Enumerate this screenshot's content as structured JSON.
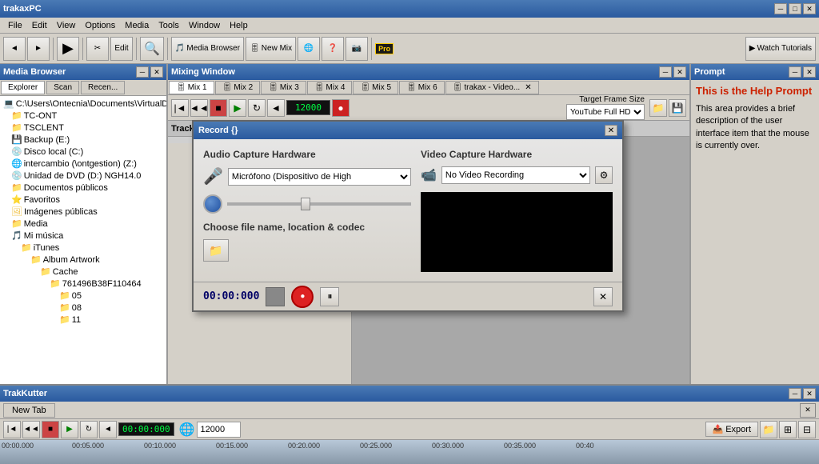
{
  "app": {
    "title": "trakaxPC",
    "title_controls": [
      "minimize",
      "maximize",
      "close"
    ]
  },
  "menu": {
    "items": [
      "File",
      "Edit",
      "View",
      "Options",
      "Media",
      "Tools",
      "Window",
      "Help"
    ]
  },
  "toolbar": {
    "buttons": [
      "back",
      "forward",
      "play",
      "edit",
      "search",
      "media_browser",
      "new_mix",
      "globe",
      "help",
      "camera",
      "watch_tutorials"
    ],
    "media_browser_label": "Media Browser",
    "new_mix_label": "New Mix",
    "watch_tutorials_label": "Watch Tutorials",
    "pro_badge": "Pro"
  },
  "left_panel": {
    "title": "Media Browser",
    "tabs": [
      "Explorer",
      "Scan",
      "Recen..."
    ],
    "tree": [
      {
        "label": "C:\\Users\\Ontecnia\\Documents\\VirtualDJL...",
        "level": 0
      },
      {
        "label": "TC-ONT",
        "level": 1
      },
      {
        "label": "TSCLENT",
        "level": 1
      },
      {
        "label": "Backup (E:)",
        "level": 1
      },
      {
        "label": "Disco local (C:)",
        "level": 1
      },
      {
        "label": "intercambio (\\ontgestion) (Z:)",
        "level": 1
      },
      {
        "label": "Unidad de DVD (D:) NGH14.0",
        "level": 1
      },
      {
        "label": "Documentos públicos",
        "level": 1
      },
      {
        "label": "Favoritos",
        "level": 1
      },
      {
        "label": "Imágenes públicas",
        "level": 1
      },
      {
        "label": "Media",
        "level": 1
      },
      {
        "label": "Mi música",
        "level": 1
      },
      {
        "label": "iTunes",
        "level": 2
      },
      {
        "label": "Album Artwork",
        "level": 3
      },
      {
        "label": "Cache",
        "level": 4
      },
      {
        "label": "761496B38F110464",
        "level": 5
      },
      {
        "label": "05",
        "level": 5
      },
      {
        "label": "08",
        "level": 5
      },
      {
        "label": "11",
        "level": 5
      }
    ]
  },
  "mixing_window": {
    "title": "Mixing Window",
    "tabs": [
      "Mix 1",
      "Mix 2",
      "Mix 3",
      "Mix 4",
      "Mix 5",
      "Mix 6",
      "trakax - Video..."
    ],
    "target_frame_label": "Target Frame Size",
    "target_frame_value": "YouTube Full HD",
    "track_label": "Track"
  },
  "record_dialog": {
    "title": "Record {}",
    "audio_section": "Audio Capture Hardware",
    "audio_device": "Micrófono (Dispositivo de High",
    "video_section": "Video Capture Hardware",
    "video_device": "No Video Recording",
    "file_section": "Choose file name, location & codec",
    "time_counter": "00:00:000",
    "buttons": {
      "stop": "stop",
      "record": "record",
      "pause": "pause",
      "close": "close"
    }
  },
  "prompt": {
    "title": "Prompt",
    "heading": "This is the Help Prompt",
    "body": "This area provides a brief description of the user interface item that the mouse is currently over."
  },
  "trakkutter": {
    "title": "TrakKutter",
    "new_tab_label": "New Tab",
    "time_display": "00:00:000",
    "bpm_value": "12000",
    "export_label": "Export",
    "timeline_markers": [
      "00:00.000",
      "00:05.000",
      "00:10.000",
      "00:15.000",
      "00:20.000",
      "00:25.000",
      "00:30.000",
      "00:35.000",
      "00:40"
    ]
  }
}
